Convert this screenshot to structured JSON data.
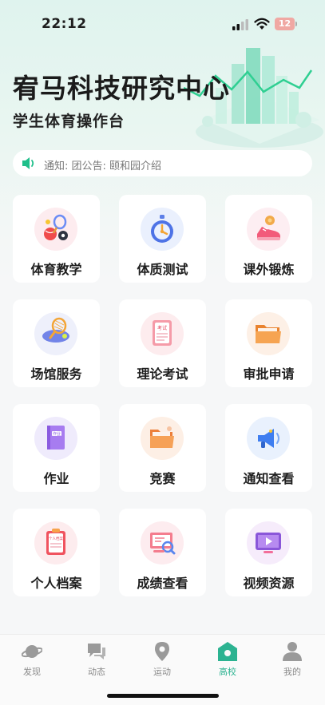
{
  "status_bar": {
    "time": "22:12",
    "battery_level": "12",
    "battery_color": "#f0a8a3"
  },
  "header": {
    "title": "宥马科技研究中心",
    "subtitle": "学生体育操作台"
  },
  "notice": {
    "prefix": "通知:",
    "text": "团公告: 颐和园介绍",
    "icon": "speaker-icon"
  },
  "tiles": [
    {
      "label": "体育教学",
      "icon": "sports-equipment-icon"
    },
    {
      "label": "体质测试",
      "icon": "stopwatch-icon"
    },
    {
      "label": "课外锻炼",
      "icon": "running-shoe-icon"
    },
    {
      "label": "场馆服务",
      "icon": "tennis-racket-icon"
    },
    {
      "label": "理论考试",
      "icon": "exam-paper-icon"
    },
    {
      "label": "审批申请",
      "icon": "folder-icon"
    },
    {
      "label": "作业",
      "icon": "homework-book-icon"
    },
    {
      "label": "竞赛",
      "icon": "competition-folder-icon"
    },
    {
      "label": "通知查看",
      "icon": "megaphone-icon"
    },
    {
      "label": "个人档案",
      "icon": "profile-clipboard-icon"
    },
    {
      "label": "成绩查看",
      "icon": "score-chart-icon"
    },
    {
      "label": "视频资源",
      "icon": "video-player-icon"
    }
  ],
  "tile_icon_text": {
    "exam": "考试",
    "homework": "作业",
    "profile": "个人档案"
  },
  "tab_bar": {
    "active_color": "#2cb391",
    "tabs": [
      {
        "label": "发现",
        "icon": "planet-icon",
        "active": false
      },
      {
        "label": "动态",
        "icon": "chat-icon",
        "active": false
      },
      {
        "label": "运动",
        "icon": "location-pin-icon",
        "active": false
      },
      {
        "label": "高校",
        "icon": "school-icon",
        "active": true
      },
      {
        "label": "我的",
        "icon": "person-icon",
        "active": false
      }
    ]
  }
}
